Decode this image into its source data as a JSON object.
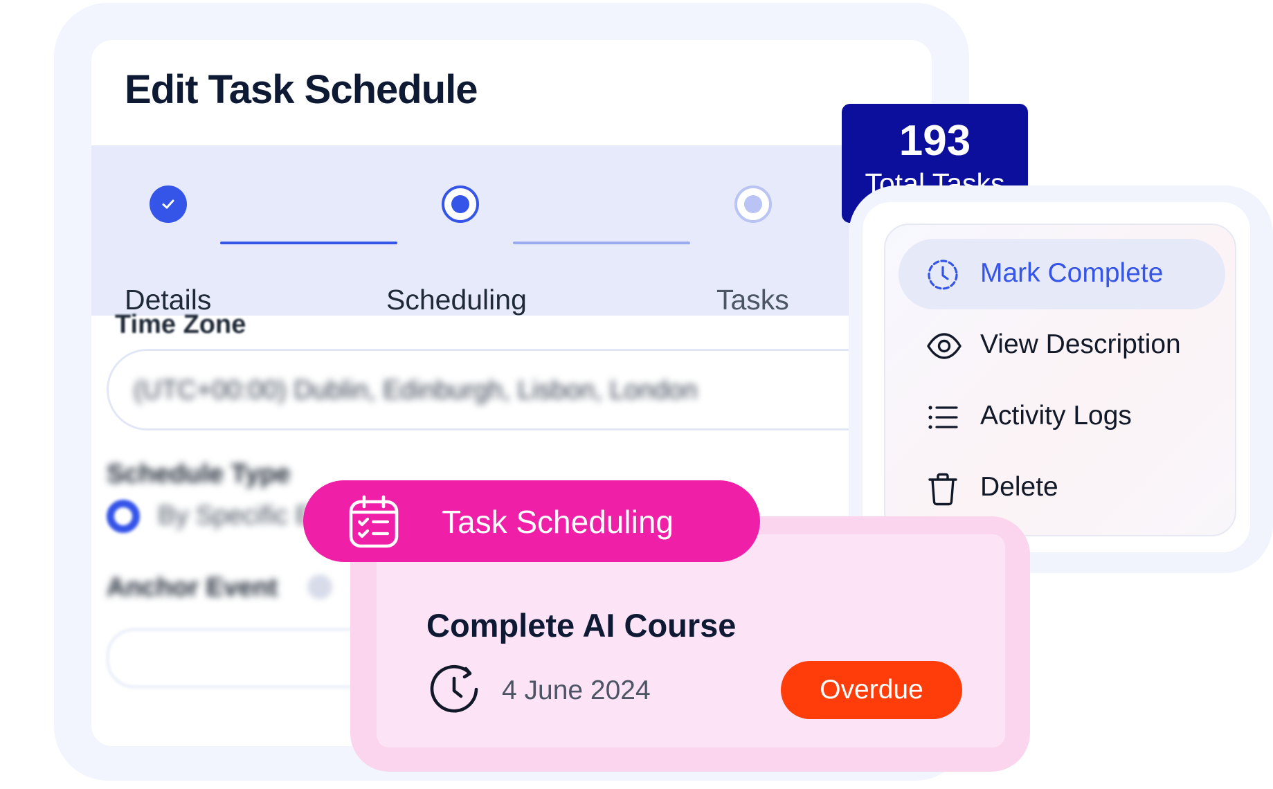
{
  "edit_card": {
    "title": "Edit Task Schedule",
    "stepper": {
      "steps": [
        {
          "label": "Details",
          "state": "completed"
        },
        {
          "label": "Scheduling",
          "state": "current"
        },
        {
          "label": "Tasks",
          "state": "upcoming"
        }
      ]
    },
    "form": {
      "time_zone_label": "Time Zone",
      "time_zone_value": "(UTC+00:00) Dublin, Edinburgh, Lisbon, London",
      "schedule_type_label": "Schedule Type",
      "schedule_type_option": "By Specific Event",
      "anchor_event_label": "Anchor Event"
    }
  },
  "total_tasks": {
    "count": "193",
    "label": "Total Tasks"
  },
  "context_menu": {
    "items": [
      {
        "label": "Mark Complete",
        "icon": "clock-dashed-icon",
        "active": true
      },
      {
        "label": "View Description",
        "icon": "eye-icon",
        "active": false
      },
      {
        "label": "Activity Logs",
        "icon": "list-icon",
        "active": false
      },
      {
        "label": "Delete",
        "icon": "trash-icon",
        "active": false
      }
    ]
  },
  "task_card": {
    "pill_label": "Task Scheduling",
    "pill_icon": "calendar-checklist-icon",
    "task_name": "Complete AI Course",
    "date": "4 June 2024",
    "date_icon": "history-icon",
    "status": "Overdue"
  },
  "colors": {
    "primary_blue": "#3554e8",
    "badge_navy": "#0b0f9c",
    "pill_magenta": "#ef1fa8",
    "overdue_red": "#ff3d0b",
    "stepper_band": "#e6eafb"
  }
}
